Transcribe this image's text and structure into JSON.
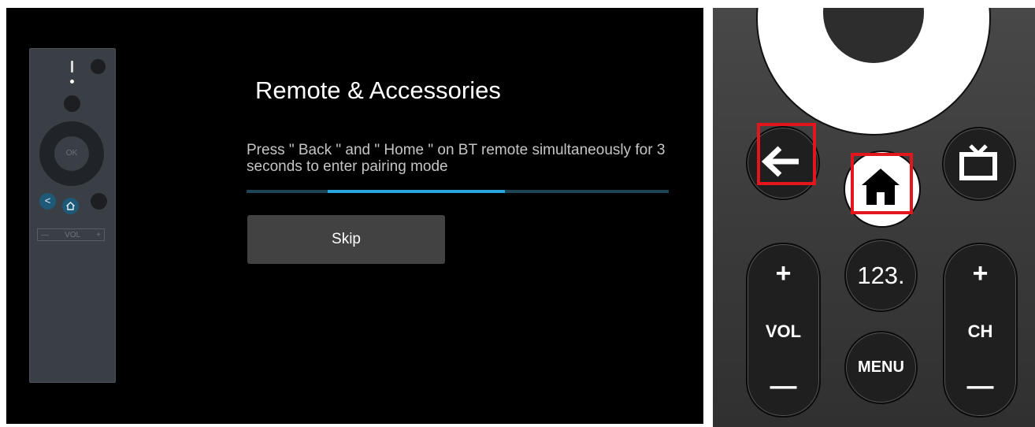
{
  "tv_screen": {
    "title": "Remote & Accessories",
    "instruction": "Press \" Back \" and \" Home \" on BT remote simultaneously for 3 seconds to enter pairing mode",
    "progress_fraction": 0.42,
    "skip_label": "Skip",
    "remote_illustration": {
      "ok_label": "OK",
      "back_symbol": "<",
      "vol_minus": "—",
      "vol_label": "VOL",
      "vol_plus": "+"
    }
  },
  "remote_photo": {
    "back_icon": "arrow-left-icon",
    "home_icon": "home-icon",
    "tv_icon": "tv-icon",
    "numbers_label": "123.",
    "menu_label": "MENU",
    "vol_plus": "+",
    "vol_label": "VOL",
    "vol_minus": "—",
    "ch_plus": "+",
    "ch_label": "CH",
    "ch_minus": "—",
    "highlight_color": "#e3161e"
  },
  "colors": {
    "progress_track": "#1d4457",
    "progress_fill": "#2aa6df",
    "skip_button": "#424242"
  }
}
